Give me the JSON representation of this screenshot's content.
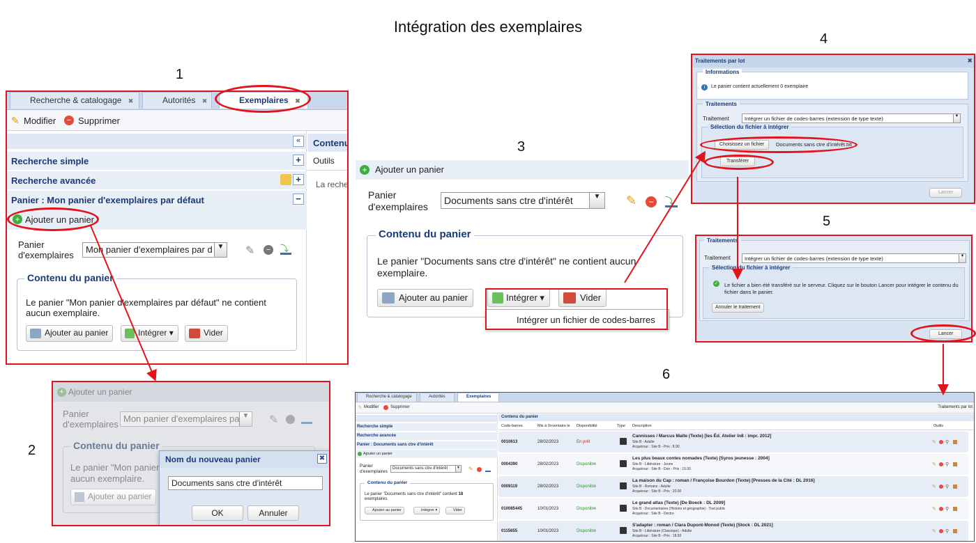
{
  "title": "Intégration des exemplaires",
  "steps": [
    "1",
    "2",
    "3",
    "4",
    "5",
    "6"
  ],
  "p1": {
    "tabs": [
      "Recherche & catalogage",
      "Autorités",
      "Exemplaires"
    ],
    "toolbar": {
      "modify": "Modifier",
      "delete": "Supprimer"
    },
    "right_header": "Contenu",
    "right_outils": "Outils",
    "right_text": "La recher",
    "simple": "Recherche simple",
    "advanced": "Recherche avancée",
    "panier_title": "Panier : Mon panier d'exemplaires par défaut",
    "add_basket": "Ajouter un panier",
    "label": "Panier\nd'exemplaires",
    "select": "Mon panier d'exemplaires par d",
    "content_legend": "Contenu du panier",
    "content_text": "Le panier \"Mon panier d'exemplaires par défaut\" ne contient aucun exemplaire.",
    "btn_add": "Ajouter au panier",
    "btn_integrate": "Intégrer",
    "btn_empty": "Vider"
  },
  "p2": {
    "add_basket": "Ajouter un panier",
    "label": "Panier\nd'exemplaires",
    "select": "Mon panier d'exemplaires par d",
    "content_legend": "Contenu du panier",
    "content_text": "Le panier \"Mon panier d",
    "content_text2": "aucun exemplaire.",
    "btn_add": "Ajouter au panier",
    "dialog_title": "Nom du nouveau panier",
    "dialog_value": "Documents sans ctre d'intérêt",
    "ok": "OK",
    "cancel": "Annuler"
  },
  "p3": {
    "add_basket": "Ajouter un panier",
    "label": "Panier\nd'exemplaires",
    "select": "Documents sans ctre d'intérêt",
    "content_legend": "Contenu du panier",
    "content_text": "Le panier \"Documents sans ctre d'intérêt\" ne contient aucun exemplaire.",
    "btn_add": "Ajouter au panier",
    "btn_integrate": "Intégrer",
    "btn_empty": "Vider",
    "menu_item": "Intégrer un fichier de codes-barres"
  },
  "p4": {
    "title": "Traitements par lot",
    "info_legend": "Informations",
    "info_text": "Le panier contient actuellement 0 exemplaire",
    "trait_legend": "Traitements",
    "trait_label": "Traitement",
    "trait_select": "Intégrer un fichier de codes-barres (extension de type texte)",
    "file_legend": "Sélection du fichier à intégrer",
    "choose": "Choisissez un fichier",
    "filename": "Documents sans ctre d'intérêt.txt",
    "transfer": "Transférer",
    "launch": "Lancer"
  },
  "p5": {
    "trait_legend": "Traitements",
    "trait_label": "Traitement",
    "trait_select": "Intégrer un fichier de codes-barres (extension de type texte)",
    "file_legend": "Sélection du fichier à intégrer",
    "msg": "Le fichier a bien été transféré sur le serveur. Cliquez sur le bouton Lancer pour intégrer le contenu du fichier dans le panier.",
    "cancel": "Annuler le traitement",
    "launch": "Lancer"
  },
  "p6": {
    "tabs": [
      "Recherche & catalogage",
      "Autorités",
      "Exemplaires"
    ],
    "modify": "Modifier",
    "delete": "Supprimer",
    "batch": "Traitements par lot",
    "simple": "Recherche simple",
    "advanced": "Recherche avancée",
    "panier_title": "Panier : Documents sans ctre d'intérêt",
    "add_basket": "Ajouter un panier",
    "label": "Panier\nd'exemplaires",
    "select": "Documents sans ctre d'intérêt",
    "content_legend": "Contenu du panier",
    "content_text": "Le panier \"Documents sans ctre d'intérêt\" contient",
    "count": "18",
    "content_text2": "exemplaires.",
    "btn_add": "Ajouter au panier",
    "btn_integrate": "Intégrer",
    "btn_empty": "Vider",
    "table_title": "Contenu du panier",
    "columns": [
      "Code-barres",
      "Mis à l'inventaire le",
      "Disponibilité",
      "Type",
      "Description",
      "Outils"
    ],
    "rows": [
      {
        "code": "0010613",
        "date": "28/02/2023",
        "status": "En prêt",
        "status_color": "#d42020",
        "title": "Cannisses / Marcus Malte (Texte) [les Éd. Atelier In8 : impr. 2012]",
        "line2": "Site B - Adulte",
        "line3": "Acquéreur : Site B - Prix : 8.90"
      },
      {
        "code": "0004390",
        "date": "28/02/2023",
        "status": "Disponible",
        "status_color": "#1e9e2a",
        "title": "Les plus beaux contes nomades (Texte) [Syros jeunesse : 2004]",
        "line2": "Site B - Littérature - Jeune",
        "line3": "Acquéreur : Site B - Don - Prix : 15.00"
      },
      {
        "code": "0009119",
        "date": "28/02/2023",
        "status": "Disponible",
        "status_color": "#1e9e2a",
        "title": "La maison du Cap : roman / Françoise Bourdon (Texte) [Presses de la Cité : DL 2016]",
        "line2": "Site B - Romans - Adulte",
        "line3": "Acquéreur : Site B - Prix : 20.00"
      },
      {
        "code": "010085445",
        "date": "10/01/2023",
        "status": "Disponible",
        "status_color": "#1e9e2a",
        "title": "Le grand atlas (Texte) [De Boeck : DL 2009]",
        "line2": "Site B - Documentaires (Histoire et géographie) - Tout public",
        "line3": "Acquéreur : Site B - Dectre"
      },
      {
        "code": "0115655",
        "date": "10/01/2023",
        "status": "Disponible",
        "status_color": "#1e9e2a",
        "title": "S'adapter : roman / Clara Dupont-Monod (Texte) [Stock : DL 2021]",
        "line2": "Site B - Littérature (Classique) - Adulte",
        "line3": "Acquéreur : Site B - Prix : 18.50"
      }
    ]
  }
}
